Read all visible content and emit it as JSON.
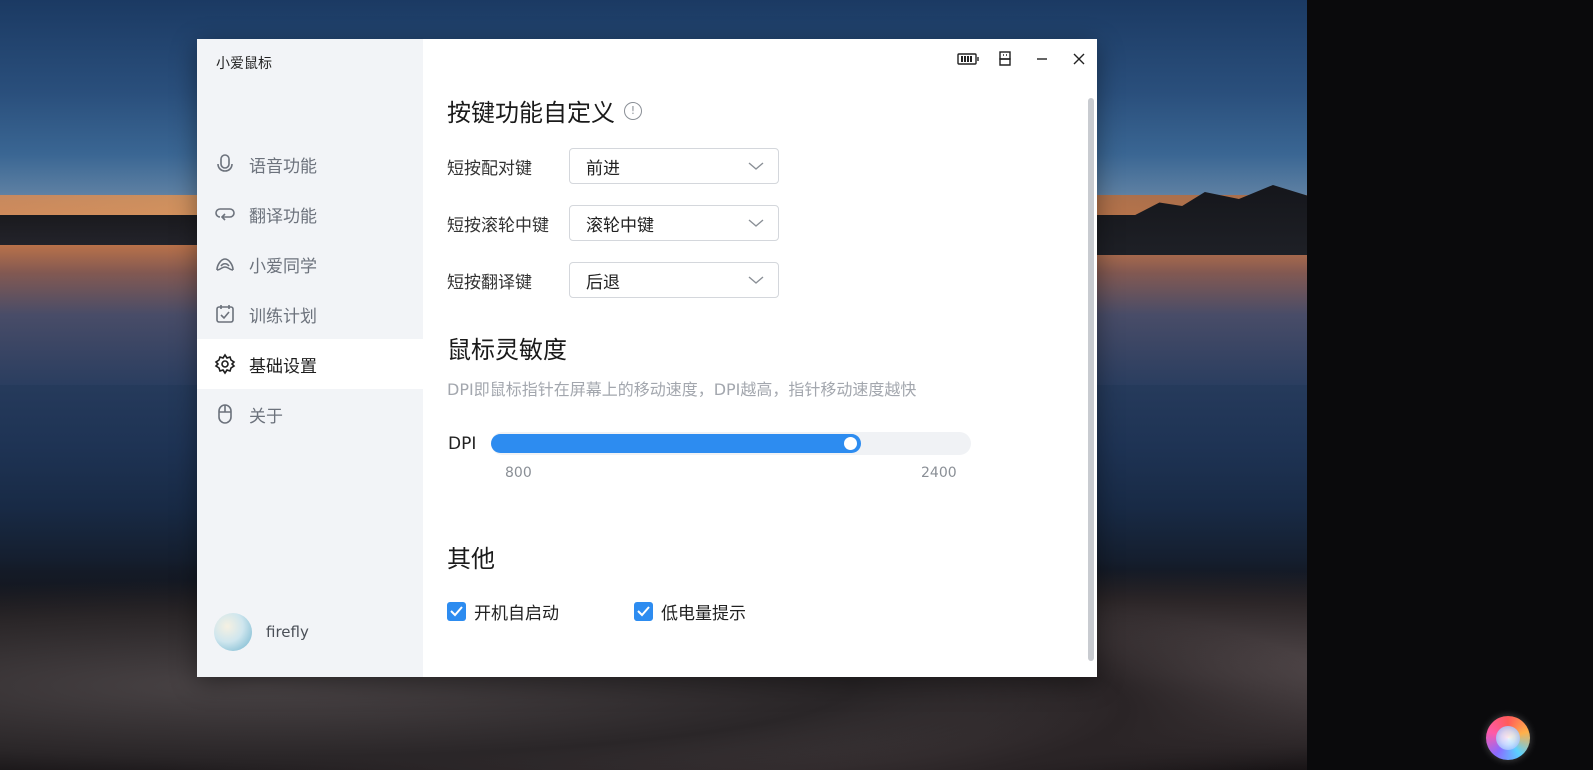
{
  "window": {
    "title": "小爱鼠标"
  },
  "sidebar": {
    "items": [
      {
        "label": "语音功能",
        "icon": "microphone-icon",
        "active": false
      },
      {
        "label": "翻译功能",
        "icon": "translate-loop-icon",
        "active": false
      },
      {
        "label": "小爱同学",
        "icon": "xiaoai-icon",
        "active": false
      },
      {
        "label": "训练计划",
        "icon": "calendar-check-icon",
        "active": false
      },
      {
        "label": "基础设置",
        "icon": "gear-icon",
        "active": true
      },
      {
        "label": "关于",
        "icon": "mouse-icon",
        "active": false
      }
    ],
    "user": {
      "name": "firefly"
    }
  },
  "main": {
    "keys_section": {
      "title": "按键功能自定义",
      "info_icon": "info-icon"
    },
    "key_rows": [
      {
        "label": "短按配对键",
        "value": "前进"
      },
      {
        "label": "短按滚轮中键",
        "value": "滚轮中键"
      },
      {
        "label": "短按翻译键",
        "value": "后退"
      }
    ],
    "sensitivity": {
      "title": "鼠标灵敏度",
      "description": "DPI即鼠标指针在屏幕上的移动速度，DPI越高，指针移动速度越快",
      "dpi_label": "DPI",
      "min_label": "800",
      "max_label": "2400",
      "level_fraction": 0.77
    },
    "other": {
      "title": "其他",
      "autostart_label": "开机自启动",
      "autostart_checked": true,
      "low_battery_label": "低电量提示",
      "low_battery_checked": true
    }
  },
  "colors": {
    "accent": "#2d8cf0",
    "sidebar_bg": "#f2f4f7"
  }
}
